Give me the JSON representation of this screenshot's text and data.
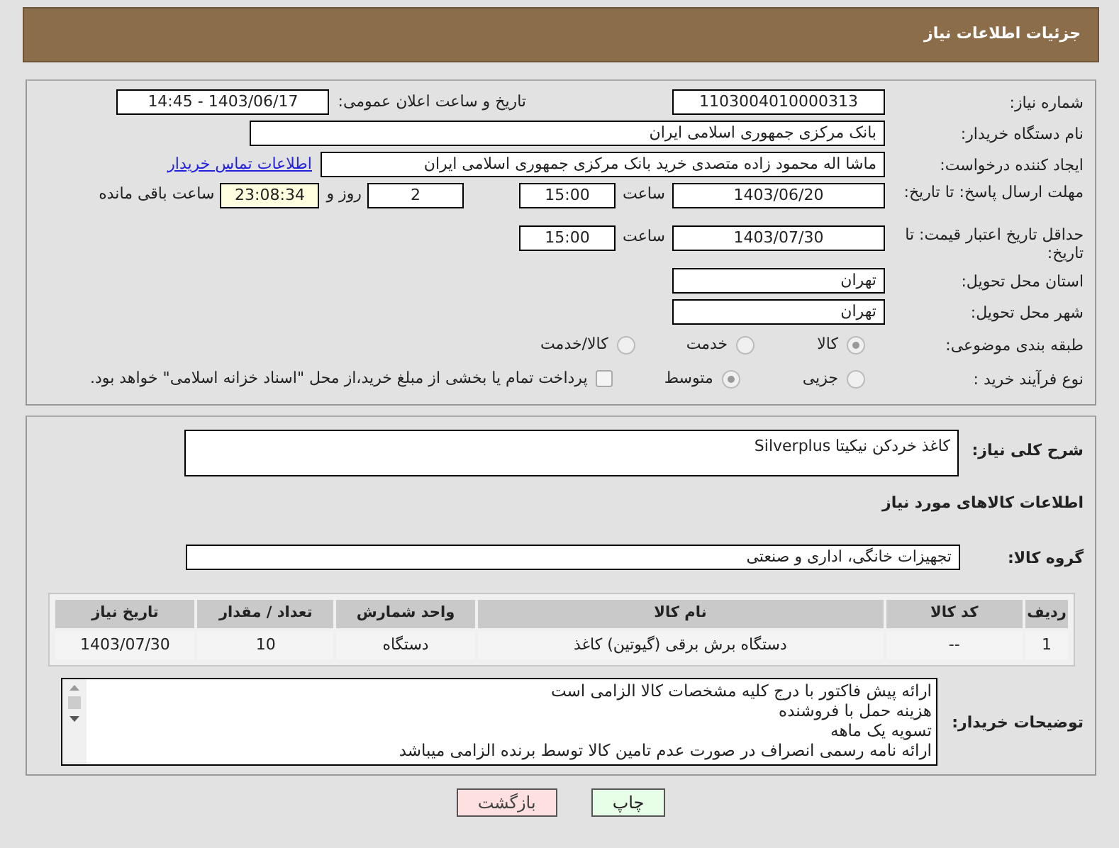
{
  "header": {
    "title": "جزئیات اطلاعات نیاز"
  },
  "need_number": {
    "label": "شماره نیاز:",
    "value": "1103004010000313"
  },
  "announce": {
    "label": "تاریخ و ساعت اعلان عمومی:",
    "value": "1403/06/17 - 14:45"
  },
  "buyer_org": {
    "label": "نام دستگاه خریدار:",
    "value": "بانک مرکزی جمهوری اسلامی ایران"
  },
  "requester": {
    "label": "ایجاد کننده درخواست:",
    "value": "ماشا اله محمود زاده متصدی خرید بانک مرکزی جمهوری اسلامی ایران",
    "link": "اطلاعات تماس خریدار"
  },
  "reply_deadline": {
    "label": "مهلت ارسال پاسخ: تا تاریخ:",
    "date": "1403/06/20",
    "time_label": "ساعت",
    "time": "15:00",
    "days": "2",
    "days_label": "روز و",
    "remaining": "23:08:34",
    "remaining_label": "ساعت باقی مانده"
  },
  "price_validity": {
    "label": "حداقل تاریخ اعتبار قیمت: تا تاریخ:",
    "date": "1403/07/30",
    "time_label": "ساعت",
    "time": "15:00"
  },
  "province": {
    "label": "استان محل تحویل:",
    "value": "تهران"
  },
  "city": {
    "label": "شهر محل تحویل:",
    "value": "تهران"
  },
  "category": {
    "label": "طبقه بندی موضوعی:",
    "options": [
      {
        "label": "کالا",
        "selected": true
      },
      {
        "label": "خدمت",
        "selected": false
      },
      {
        "label": "کالا/خدمت",
        "selected": false
      }
    ]
  },
  "process": {
    "label": "نوع فرآیند خرید :",
    "options": [
      {
        "label": "جزیی",
        "selected": false
      },
      {
        "label": "متوسط",
        "selected": true
      }
    ],
    "payment": {
      "checked": false,
      "text": "پرداخت تمام یا بخشی از مبلغ خرید،از محل \"اسناد خزانه اسلامی\" خواهد بود."
    }
  },
  "description": {
    "label": "شرح کلی نیاز:",
    "value": "کاغذ خردکن نیکیتا Silverplus"
  },
  "goods_heading": "اطلاعات کالاهای مورد نیاز",
  "goods_group": {
    "label": "گروه کالا:",
    "value": "تجهیزات خانگی، اداری و صنعتی"
  },
  "table": {
    "columns": [
      "ردیف",
      "کد کالا",
      "نام کالا",
      "واحد شمارش",
      "تعداد / مقدار",
      "تاریخ نیاز"
    ],
    "rows": [
      [
        "1",
        "--",
        "دستگاه برش برقی (گیوتین) کاغذ",
        "دستگاه",
        "10",
        "1403/07/30"
      ]
    ]
  },
  "buyer_notes": {
    "label": "توضیحات خریدار:",
    "lines": [
      "ارائه پیش فاکتور با درج کلیه مشخصات کالا الزامی است",
      "هزینه حمل با فروشنده",
      "تسویه یک ماهه",
      "ارائه نامه رسمی انصراف در صورت عدم تامین کالا توسط برنده الزامی میباشد"
    ]
  },
  "buttons": [
    {
      "label": "چاپ",
      "kind": "print"
    },
    {
      "label": "بازگشت",
      "kind": "back"
    }
  ]
}
